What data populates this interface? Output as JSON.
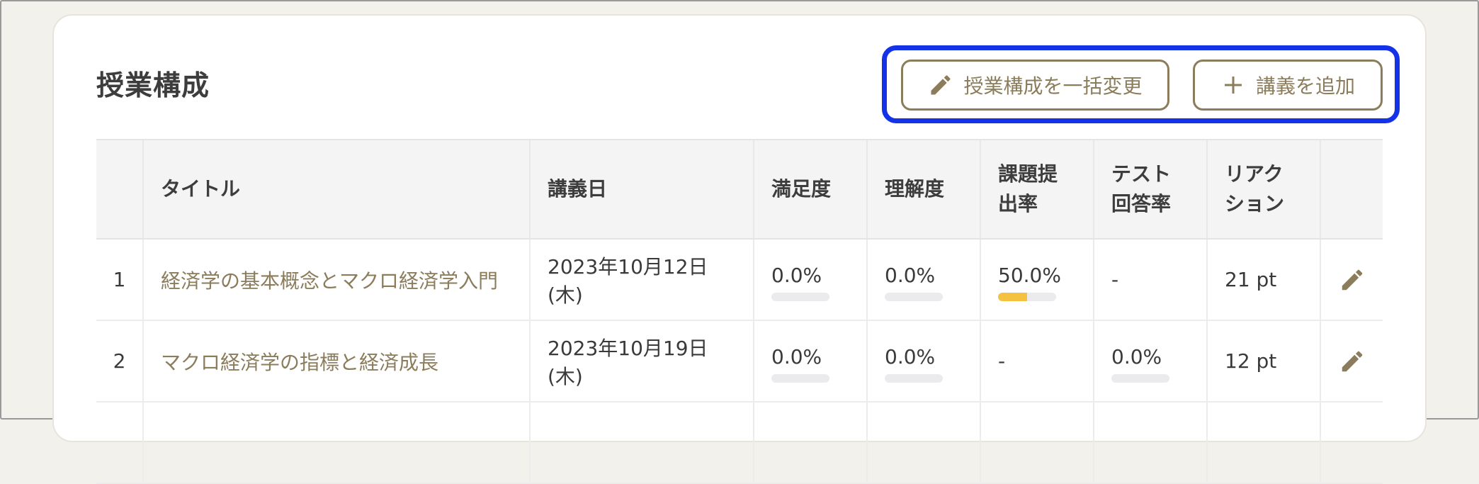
{
  "page": {
    "title": "授業構成"
  },
  "actions": {
    "bulk_edit_label": "授業構成を一括変更",
    "add_lecture_label": "講義を追加"
  },
  "table": {
    "headers": {
      "title": "タイトル",
      "date": "講義日",
      "satisfaction": "満足度",
      "understanding": "理解度",
      "submission_line1": "課題提",
      "submission_line2": "出率",
      "test_line1": "テスト",
      "test_line2": "回答率",
      "reaction_line1": "リアク",
      "reaction_line2": "ション"
    },
    "rows": [
      {
        "index": "1",
        "title": "経済学の基本概念とマクロ経済学入門",
        "date": "2023年10月12日(木)",
        "satisfaction": "0.0%",
        "satisfaction_value": 0,
        "understanding": "0.0%",
        "understanding_value": 0,
        "submission": "50.0%",
        "submission_value": 50,
        "test": "-",
        "reaction": "21 pt"
      },
      {
        "index": "2",
        "title": "マクロ経済学の指標と経済成長",
        "date": "2023年10月19日(木)",
        "satisfaction": "0.0%",
        "satisfaction_value": 0,
        "understanding": "0.0%",
        "understanding_value": 0,
        "submission": "-",
        "test": "0.0%",
        "test_value": 0,
        "reaction": "12 pt"
      }
    ]
  },
  "colors": {
    "accent": "#8b7d5c",
    "highlight": "#1432e6",
    "progress": "#f5c140"
  },
  "icons": {
    "bulk_edit": "pencil-icon",
    "add": "plus-icon",
    "row_edit": "pencil-icon"
  }
}
